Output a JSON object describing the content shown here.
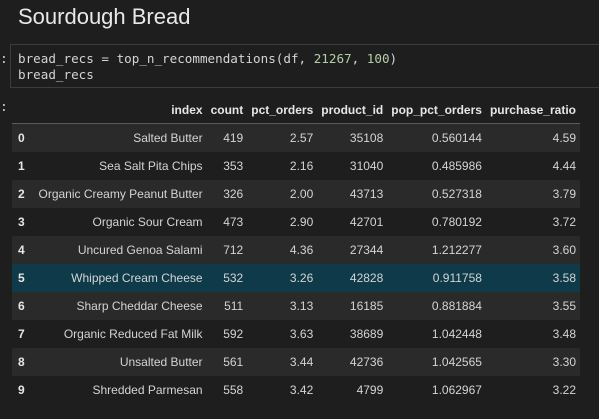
{
  "heading": "Sourdough Bread",
  "prompt": ":",
  "code": {
    "line1_a": "bread_recs = top_n_recommendations(df, ",
    "line1_num1": "21267",
    "line1_b": ", ",
    "line1_num2": "100",
    "line1_c": ")",
    "line2": "bread_recs"
  },
  "table": {
    "columns": [
      "index",
      "count",
      "pct_orders",
      "product_id",
      "pop_pct_orders",
      "purchase_ratio"
    ],
    "rows": [
      {
        "idx": "0",
        "index": "Salted Butter",
        "count": "419",
        "pct_orders": "2.57",
        "product_id": "35108",
        "pop_pct_orders": "0.560144",
        "purchase_ratio": "4.59"
      },
      {
        "idx": "1",
        "index": "Sea Salt Pita Chips",
        "count": "353",
        "pct_orders": "2.16",
        "product_id": "31040",
        "pop_pct_orders": "0.485986",
        "purchase_ratio": "4.44"
      },
      {
        "idx": "2",
        "index": "Organic Creamy Peanut Butter",
        "count": "326",
        "pct_orders": "2.00",
        "product_id": "43713",
        "pop_pct_orders": "0.527318",
        "purchase_ratio": "3.79"
      },
      {
        "idx": "3",
        "index": "Organic Sour Cream",
        "count": "473",
        "pct_orders": "2.90",
        "product_id": "42701",
        "pop_pct_orders": "0.780192",
        "purchase_ratio": "3.72"
      },
      {
        "idx": "4",
        "index": "Uncured Genoa Salami",
        "count": "712",
        "pct_orders": "4.36",
        "product_id": "27344",
        "pop_pct_orders": "1.212277",
        "purchase_ratio": "3.60"
      },
      {
        "idx": "5",
        "index": "Whipped Cream Cheese",
        "count": "532",
        "pct_orders": "3.26",
        "product_id": "42828",
        "pop_pct_orders": "0.911758",
        "purchase_ratio": "3.58"
      },
      {
        "idx": "6",
        "index": "Sharp Cheddar Cheese",
        "count": "511",
        "pct_orders": "3.13",
        "product_id": "16185",
        "pop_pct_orders": "0.881884",
        "purchase_ratio": "3.55"
      },
      {
        "idx": "7",
        "index": "Organic Reduced Fat Milk",
        "count": "592",
        "pct_orders": "3.63",
        "product_id": "38689",
        "pop_pct_orders": "1.042448",
        "purchase_ratio": "3.48"
      },
      {
        "idx": "8",
        "index": "Unsalted Butter",
        "count": "561",
        "pct_orders": "3.44",
        "product_id": "42736",
        "pop_pct_orders": "1.042565",
        "purchase_ratio": "3.30"
      },
      {
        "idx": "9",
        "index": "Shredded Parmesan",
        "count": "558",
        "pct_orders": "3.42",
        "product_id": "4799",
        "pop_pct_orders": "1.062967",
        "purchase_ratio": "3.22"
      }
    ],
    "highlighted_row": 5
  },
  "colors": {
    "background": "#1e1e1e",
    "row_alt": "#2a2a2a",
    "row_highlight": "#0e3a4a",
    "number_token": "#b5cea8"
  }
}
